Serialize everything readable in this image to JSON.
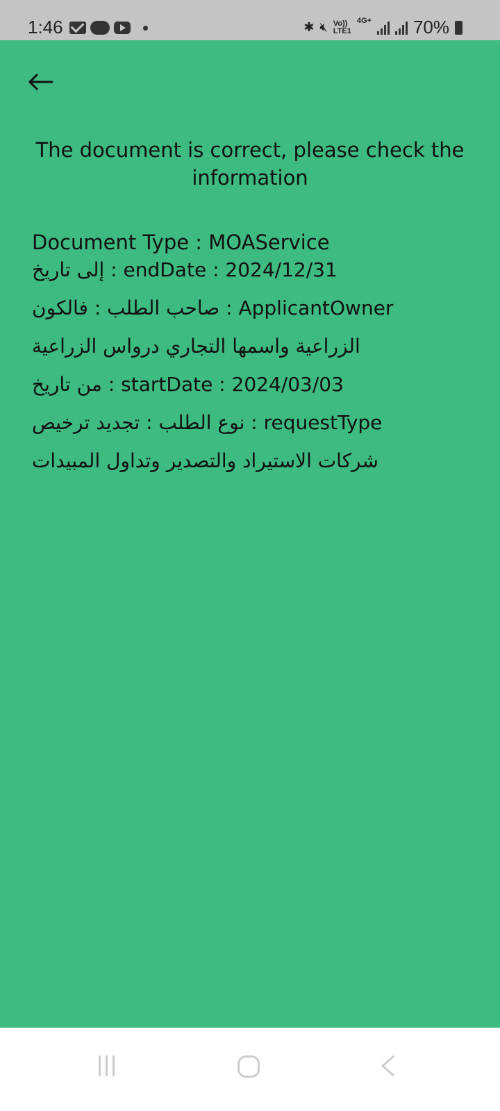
{
  "status_bar": {
    "time": "1:46",
    "left_icons": [
      "mail-icon",
      "cloud-icon",
      "youtube-icon",
      "dot-icon"
    ],
    "volte_top": "Vo))",
    "volte_bottom": "LTE1",
    "network": "4G+",
    "battery": "70%"
  },
  "header": {
    "back_icon": "arrow-left-icon"
  },
  "main": {
    "title": "The document is correct, please check the information",
    "lines": [
      "Document Type : MOAService",
      "endDate : 2024/12/31 : إلى تاريخ",
      "ApplicantOwner : صاحب الطلب : فالكون",
      "الزراعية واسمها التجاري    درواس الزراعية",
      "startDate : 2024/03/03 : من تاريخ",
      "requestType : نوع الطلب : تجديد ترخيص",
      "شركات الاستيراد والتصدير وتداول المبيدات"
    ]
  },
  "nav_bar": {
    "recent_icon": "recent-apps-icon",
    "home_icon": "home-icon",
    "back_icon": "back-icon"
  },
  "colors": {
    "background": "#3ebb80",
    "status_bar": "#c4c4c4",
    "nav_bar": "#ffffff",
    "text": "#111111"
  }
}
